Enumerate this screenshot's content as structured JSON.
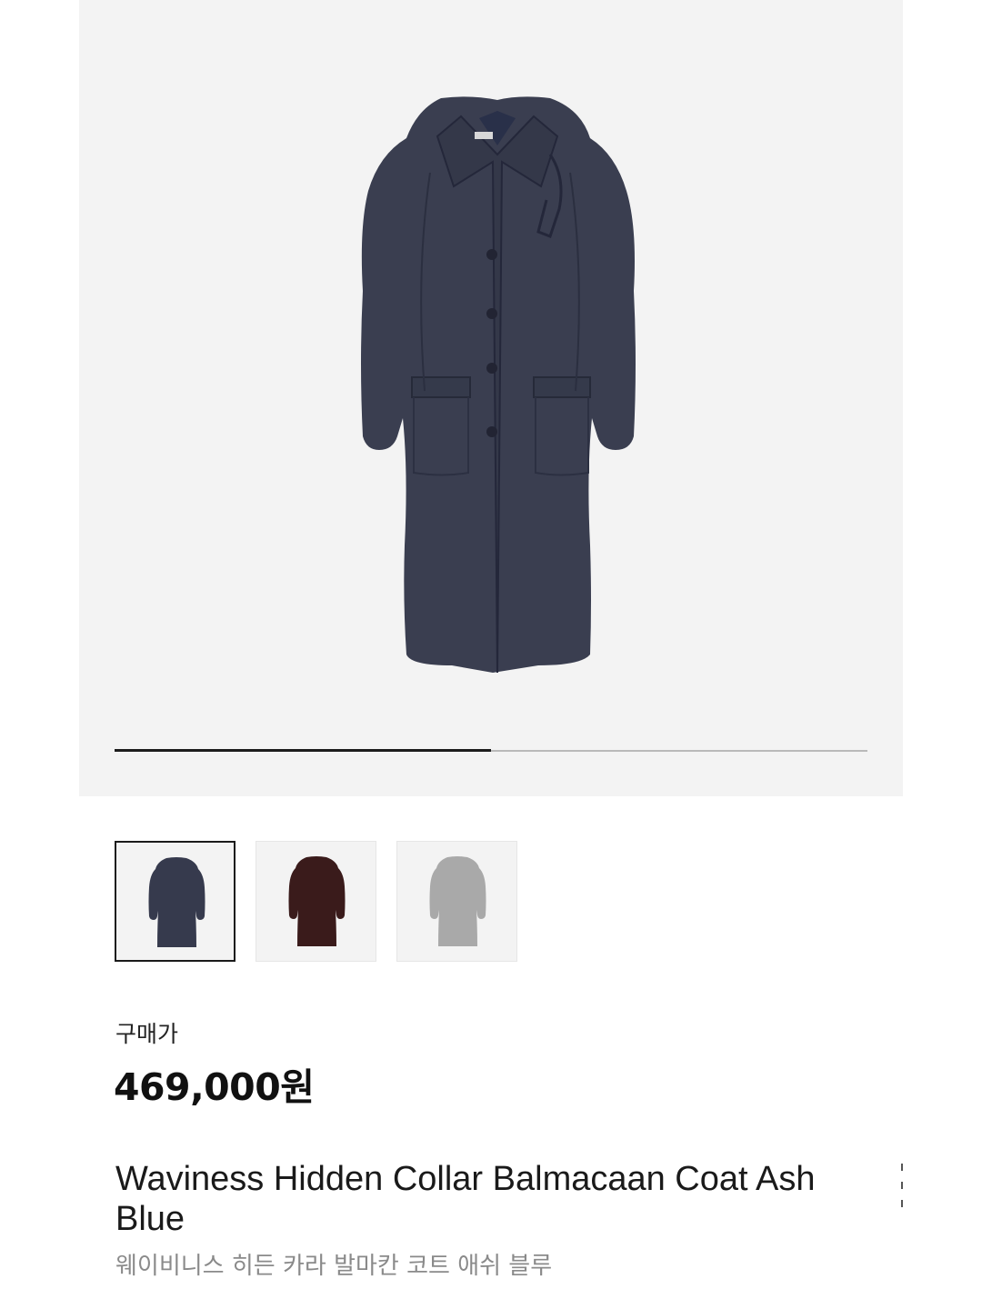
{
  "gallery": {
    "progress_fraction": 0.5,
    "current_image": "coat-ash-blue"
  },
  "color_options": [
    {
      "name": "ash-blue",
      "swatch": "#363a4d",
      "selected": true
    },
    {
      "name": "burgundy",
      "swatch": "#3a1b1b",
      "selected": false
    },
    {
      "name": "grey",
      "swatch": "#a9a9a9",
      "selected": false
    }
  ],
  "price": {
    "label": "구매가",
    "value": "469,000원"
  },
  "product": {
    "name_en": "Waviness Hidden Collar Balmacaan Coat Ash Blue",
    "name_ko": "웨이비니스 히든 카라 발마칸 코트 애쉬 블루"
  }
}
